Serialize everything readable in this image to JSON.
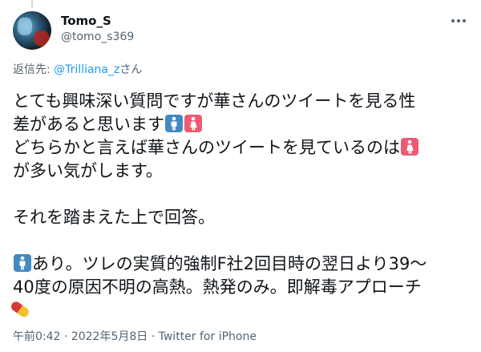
{
  "author": {
    "display_name": "Tomo_S",
    "handle": "@tomo_s369"
  },
  "reply_to": {
    "prefix": "返信先: ",
    "mention": "@Trilliana_z",
    "suffix": "さん"
  },
  "tweet": {
    "l1": "とても興味深い質問ですが華さんのツイートを見る性",
    "l2": "差があると思います",
    "l3": "どちらかと言えば華さんのツイートを見ているのは",
    "l4": "が多い気がします。",
    "l6": "それを踏まえた上で回答。",
    "l8": "あり。ツレの実質的強制F社2回目時の翌日より39～",
    "l9": "40度の原因不明の高熱。熱発のみ。即解毒アプローチ"
  },
  "meta": {
    "time": "午前0:42",
    "sep": " · ",
    "date": "2022年5月8日",
    "sep2": " · ",
    "source": "Twitter for iPhone"
  },
  "colors": {
    "text": "#0f1419",
    "secondary": "#536471",
    "accent": "#1d9bf0",
    "mens_emoji": "#4289c1",
    "womens_emoji": "#ec5a73"
  },
  "icons": [
    "more-icon",
    "mens-room-emoji",
    "womens-room-emoji",
    "pill-emoji"
  ]
}
